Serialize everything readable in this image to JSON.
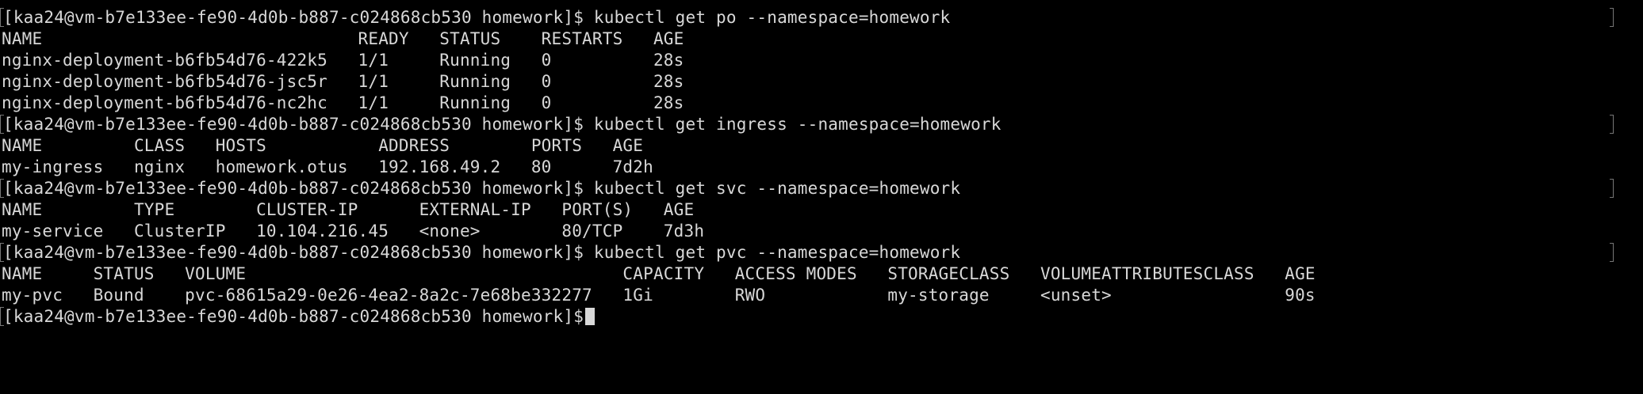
{
  "terminal": {
    "lines": [
      {
        "kind": "prompt",
        "text": "[kaa24@vm-b7e133ee-fe90-4d0b-b887-c024868cb530 homework]$ kubectl get po --namespace=homework"
      },
      {
        "kind": "output",
        "text": "NAME                               READY   STATUS    RESTARTS   AGE"
      },
      {
        "kind": "output",
        "text": "nginx-deployment-b6fb54d76-422k5   1/1     Running   0          28s"
      },
      {
        "kind": "output",
        "text": "nginx-deployment-b6fb54d76-jsc5r   1/1     Running   0          28s"
      },
      {
        "kind": "output",
        "text": "nginx-deployment-b6fb54d76-nc2hc   1/1     Running   0          28s"
      },
      {
        "kind": "prompt",
        "text": "[kaa24@vm-b7e133ee-fe90-4d0b-b887-c024868cb530 homework]$ kubectl get ingress --namespace=homework"
      },
      {
        "kind": "output",
        "text": "NAME         CLASS   HOSTS           ADDRESS        PORTS   AGE"
      },
      {
        "kind": "output",
        "text": "my-ingress   nginx   homework.otus   192.168.49.2   80      7d2h"
      },
      {
        "kind": "prompt",
        "text": "[kaa24@vm-b7e133ee-fe90-4d0b-b887-c024868cb530 homework]$ kubectl get svc --namespace=homework"
      },
      {
        "kind": "output",
        "text": "NAME         TYPE        CLUSTER-IP      EXTERNAL-IP   PORT(S)   AGE"
      },
      {
        "kind": "output",
        "text": "my-service   ClusterIP   10.104.216.45   <none>        80/TCP    7d3h"
      },
      {
        "kind": "prompt",
        "text": "[kaa24@vm-b7e133ee-fe90-4d0b-b887-c024868cb530 homework]$ kubectl get pvc --namespace=homework"
      },
      {
        "kind": "output",
        "text": "NAME     STATUS   VOLUME                                     CAPACITY   ACCESS MODES   STORAGECLASS   VOLUMEATTRIBUTESCLASS   AGE"
      },
      {
        "kind": "output",
        "text": "my-pvc   Bound    pvc-68615a29-0e26-4ea2-8a2c-7e68be332277   1Gi        RWO            my-storage     <unset>                 90s"
      },
      {
        "kind": "prompt",
        "text": "[kaa24@vm-b7e133ee-fe90-4d0b-b887-c024868cb530 homework]$",
        "cursor": true
      }
    ]
  },
  "colors": {
    "background": "#000000",
    "foreground": "#d8d8d8",
    "prompt_mark": "#777777"
  }
}
